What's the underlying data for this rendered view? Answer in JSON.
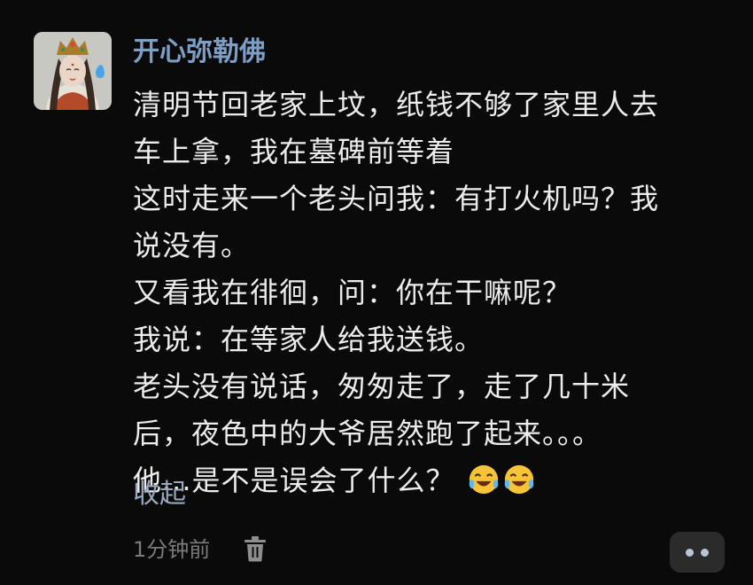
{
  "post": {
    "username": "开心弥勒佛",
    "lines": [
      "清明节回老家上坟，纸钱不够了家里人去",
      "车上拿，我在墓碑前等着",
      "这时走来一个老头问我：有打火机吗？我",
      "说没有。",
      "又看我在徘徊，问：你在干嘛呢？",
      "我说：在等家人给我送钱。",
      "老头没有说话，匆匆走了，走了几十米",
      "后，夜色中的大爷居然跑了起来。。。",
      "他...是不是误会了什么？"
    ],
    "emojis": [
      "laughing-crying-emoji",
      "laughing-crying-emoji"
    ],
    "collapse_label": "收起",
    "timestamp": "1分钟前"
  },
  "icons": {
    "delete": "trash-icon",
    "more": "more-dots-icon"
  },
  "colors": {
    "background": "#0a0a0a",
    "username": "#7d9fc6",
    "text": "#ececec",
    "link": "#98a9bd",
    "muted": "#7b7b7b"
  }
}
